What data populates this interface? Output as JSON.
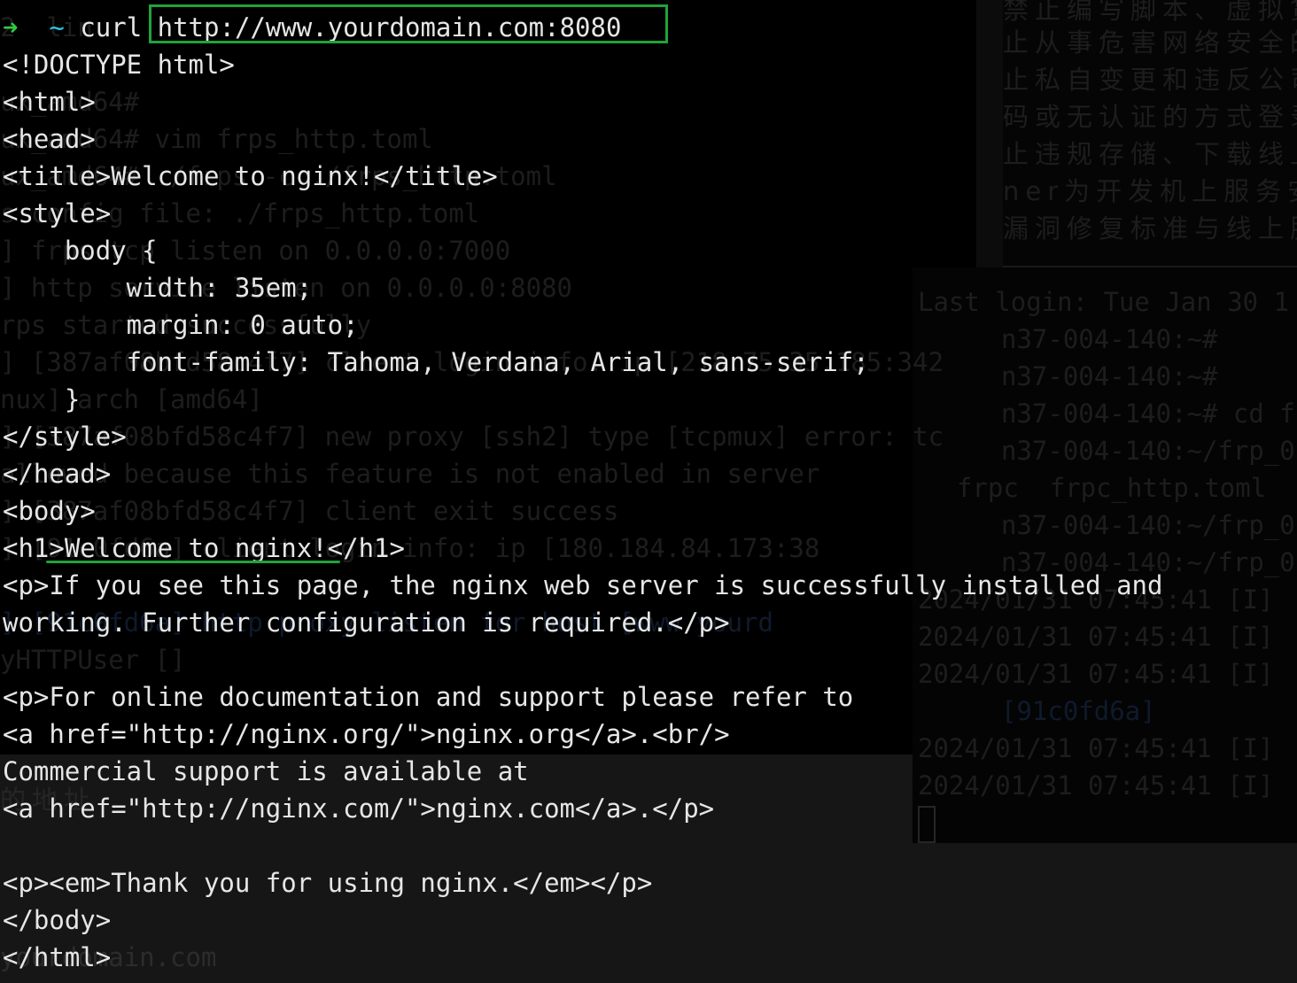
{
  "colors": {
    "background": "#000000",
    "text": "#e6e6e6",
    "prompt_arrow": "#2ecc40",
    "prompt_tilde": "#2ec4e6",
    "highlight": "#1fa33a"
  },
  "terminal": {
    "prompt": {
      "arrow": "➜",
      "cwd": "~",
      "command": "curl",
      "url": "http://www.yourdomain.com:8080"
    },
    "output": [
      "<!DOCTYPE html>",
      "<html>",
      "<head>",
      "<title>Welcome to nginx!</title>",
      "<style>",
      "    body {",
      "        width: 35em;",
      "        margin: 0 auto;",
      "        font-family: Tahoma, Verdana, Arial, sans-serif;",
      "    }",
      "</style>",
      "</head>",
      "<body>",
      "<h1>Welcome to nginx!</h1>",
      "<p>If you see this page, the nginx web server is successfully installed and",
      "working. Further configuration is required.</p>",
      "",
      "<p>For online documentation and support please refer to",
      "<a href=\"http://nginx.org/\">nginx.org</a>.<br/>",
      "Commercial support is available at",
      "<a href=\"http://nginx.com/\">nginx.com</a>.</p>",
      "",
      "<p><em>Thank you for using nginx.</em></p>",
      "</body>",
      "</html>"
    ]
  },
  "background_windows": {
    "left": [
      "2  lin",
      "ux_amd64#",
      "ux_amd64# vim frps_http.toml",
      "ux_amd64# ./frps -c ./frps_http.toml",
      "s config file: ./frps_http.toml",
      "] frps tcp listen on 0.0.0.0:7000",
      "] http service listen on 0.0.0.0:8080",
      "rps started successfully",
      "] [387af08bfd58c4f7] client login info: ip [218.75.35.185:342",
      "nux] arch [amd64]",
      "] [387af08bfd58c4f7] new proxy [ssh2] type [tcpmux] error: tc",
      "allowed because this feature is not enabled in server",
      "] [387af08bfd58c4f7] client exit success",
      "] [91c0fd6a] client login info: ip [180.184.84.173:38",
      "] [91c0fd6a] http proxy listen for host [www.yourd",
      "yHTTPUser []",
      "yourdomain.com"
    ],
    "right_top": [
      "禁止编写脚本、虚拟货币节点",
      "止从事危害网络安全的",
      "止私自变更和违反公司",
      "码或无认证的方式登录",
      "止违规存储、下载线上",
      "ner为开发机上服务安",
      "漏洞修复标准与线上服"
    ],
    "right_bottom": [
      "Last login: Tue Jan 30 1",
      "n37-004-140:~#",
      "n37-004-140:~#",
      "n37-004-140:~# cd f",
      "n37-004-140:~/frp_0",
      "frpc  frpc_http.toml  fr",
      "n37-004-140:~/frp_0",
      "n37-004-140:~/frp_0",
      "2024/01/31 07:45:41 [I]",
      "2024/01/31 07:45:41 [I]",
      "2024/01/31 07:45:41 [I]",
      "[91c0fd6a]",
      "2024/01/31 07:45:41 [I]",
      "2024/01/31 07:45:41 [I]"
    ],
    "lower_left_zh": "的地址"
  }
}
